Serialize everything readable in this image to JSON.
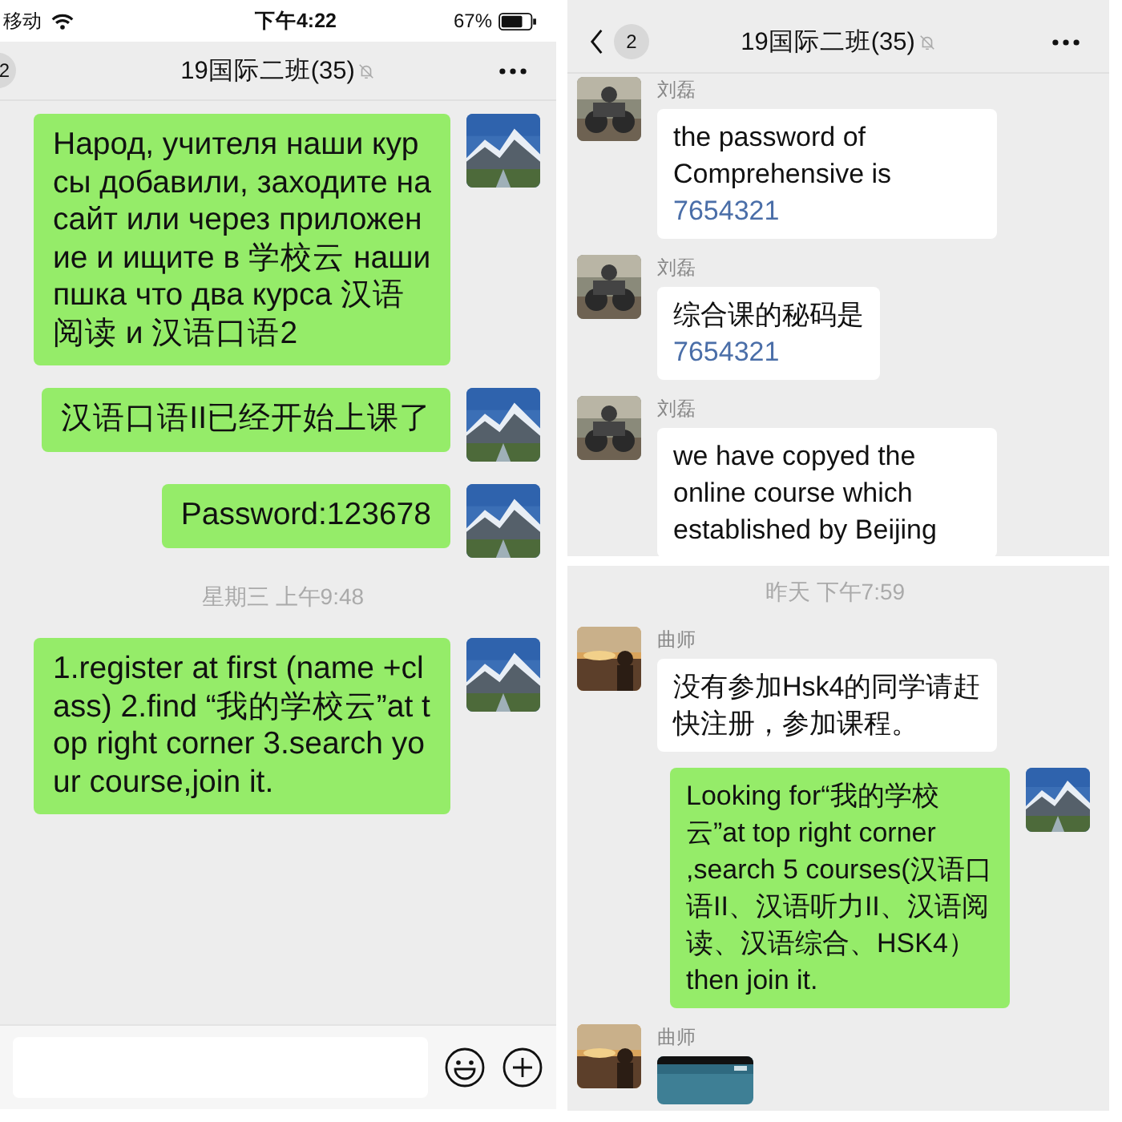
{
  "panels": [
    {
      "status_bar": {
        "carrier": "移动",
        "time": "下午4:22",
        "battery": "67%"
      },
      "header": {
        "badge": "2",
        "title": "19国际二班(35)",
        "muted": true,
        "back": false
      },
      "messages": [
        {
          "kind": "outgoing",
          "text": "Народ, учителя наши курсы добавили, заходите на сайт или через приложение и ищите в 学校云 наши пшка что два курса 汉语阅读 и 汉语口语2"
        },
        {
          "kind": "outgoing",
          "text": "汉语口语II已经开始上课了"
        },
        {
          "kind": "outgoing",
          "text": "Password:123678"
        },
        {
          "kind": "time",
          "text": "星期三 上午9:48"
        },
        {
          "kind": "outgoing",
          "text": "1.register at first (name +class) 2.find “我的学校云”at top right corner 3.search your course,join it."
        }
      ],
      "input_bar": true
    },
    {
      "header": {
        "badge": "2",
        "title": "19国际二班(35)",
        "muted": true,
        "back": true
      },
      "messages": [
        {
          "kind": "incoming",
          "sender": "刘磊",
          "text": "the password of Comprehensive is",
          "link": "7654321"
        },
        {
          "kind": "incoming",
          "sender": "刘磊",
          "text": "综合课的秘码是",
          "link": "7654321"
        },
        {
          "kind": "incoming",
          "sender": "刘磊",
          "text": "we have copyed the online course which established by Beijing"
        }
      ],
      "input_bar": false
    },
    {
      "messages": [
        {
          "kind": "time",
          "text": "昨天 下午7:59"
        },
        {
          "kind": "incoming",
          "sender": "曲师",
          "text": "没有参加Hsk4的同学请赶快注册，参加课程。"
        },
        {
          "kind": "outgoing",
          "text": "Looking for“我的学校云”at top right corner ,search 5 courses(汉语口语II、汉语听力II、汉语阅读、汉语综合、HSK4） then join it."
        },
        {
          "sender": "曲师"
        }
      ],
      "input_bar": false
    }
  ]
}
